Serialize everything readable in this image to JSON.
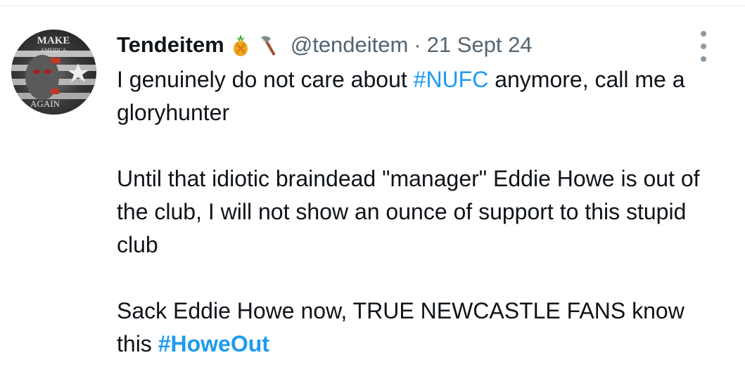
{
  "avatar": {
    "top_text": "MAKE",
    "small_text": "AMERICA",
    "bottom_text": "AGAIN",
    "icon": "avatar-image"
  },
  "tweet": {
    "display_name": "Tendeitem",
    "emoji": [
      "pineapple-emoji",
      "axe-emoji"
    ],
    "handle": "@tendeitem",
    "separator": "·",
    "date": "21 Sept 24",
    "p1_before": "I genuinely do not care about ",
    "p1_tag": "#NUFC",
    "p1_after": " anymore, call me a gloryhunter",
    "p2": "Until that idiotic braindead \"manager\" Eddie Howe is out of the club, I will not show an ounce of support to this stupid club",
    "p3_before": "Sack Eddie Howe now, TRUE NEWCASTLE FANS know this ",
    "p3_tag": "#HoweOut"
  },
  "colors": {
    "text": "#0f1419",
    "secondary": "#536471",
    "link": "#1d9bf0"
  }
}
